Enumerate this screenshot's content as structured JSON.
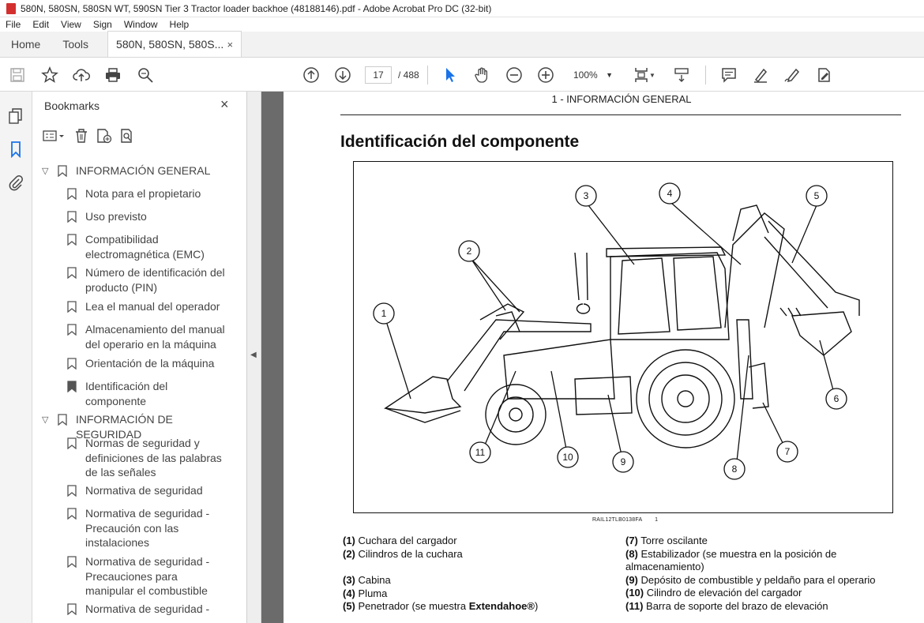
{
  "window": {
    "title": "580N, 580SN, 580SN WT, 590SN Tier 3 Tractor loader backhoe (48188146).pdf - Adobe Acrobat Pro DC (32-bit)"
  },
  "menu": [
    "File",
    "Edit",
    "View",
    "Sign",
    "Window",
    "Help"
  ],
  "tabs": {
    "home": "Home",
    "tools": "Tools",
    "document": "580N, 580SN, 580S...",
    "close": "×"
  },
  "toolbar": {
    "page_current": "17",
    "page_total": "/ 488",
    "zoom": "100%"
  },
  "bookmarks": {
    "title": "Bookmarks",
    "close": "×",
    "items": [
      {
        "label": "INFORMACIÓN GENERAL",
        "level": 0
      },
      {
        "label": "Nota para el propietario",
        "level": 1
      },
      {
        "label": "Uso previsto",
        "level": 1
      },
      {
        "label": "Compatibilidad electromagnética (EMC)",
        "level": 1
      },
      {
        "label": "Número de identificación del producto (PIN)",
        "level": 1
      },
      {
        "label": "Lea el manual del operador",
        "level": 1
      },
      {
        "label": "Almacenamiento del manual del operario en la máquina",
        "level": 1
      },
      {
        "label": "Orientación de la máquina",
        "level": 1
      },
      {
        "label": "Identificación del componente",
        "level": 1,
        "selected": true
      },
      {
        "label": "INFORMACIÓN DE SEGURIDAD",
        "level": 0
      },
      {
        "label": "Normas de seguridad y definiciones de las palabras de las señales",
        "level": 1
      },
      {
        "label": "Normativa de seguridad",
        "level": 1
      },
      {
        "label": "Normativa de seguridad - Precaución con las instalaciones",
        "level": 1
      },
      {
        "label": "Normativa de seguridad - Precauciones para manipular el combustible",
        "level": 1
      },
      {
        "label": "Normativa de seguridad -",
        "level": 1
      }
    ]
  },
  "document": {
    "running_header": "1 - INFORMACIÓN GENERAL",
    "title": "Identificación del componente",
    "figure_ref": "RAIL12TLB0138FA",
    "figure_num": "1",
    "callouts": [
      "1",
      "2",
      "3",
      "4",
      "5",
      "6",
      "7",
      "8",
      "9",
      "10",
      "11"
    ],
    "legend_left": [
      {
        "num": "(1)",
        "text": "Cuchara del cargador"
      },
      {
        "num": "(2)",
        "text": "Cilindros de la cuchara"
      },
      {
        "num": "(3)",
        "text": "Cabina"
      },
      {
        "num": "(4)",
        "text": "Pluma"
      },
      {
        "num": "(5)",
        "text": "Penetrador (se muestra ",
        "bold": "Extendahoe®",
        "tail": ")"
      }
    ],
    "legend_right": [
      {
        "num": "(7)",
        "text": "Torre oscilante"
      },
      {
        "num": "(8)",
        "text": "Estabilizador (se muestra en la posición de almacenamiento)"
      },
      {
        "num": "(9)",
        "text": "Depósito de combustible y peldaño para el operario"
      },
      {
        "num": "(10)",
        "text": "Cilindro de elevación del cargador"
      },
      {
        "num": "(11)",
        "text": "Barra de soporte del brazo de elevación"
      }
    ]
  },
  "colors": {
    "accent": "#1a73e8",
    "acrobat_red": "#d32f2f"
  }
}
